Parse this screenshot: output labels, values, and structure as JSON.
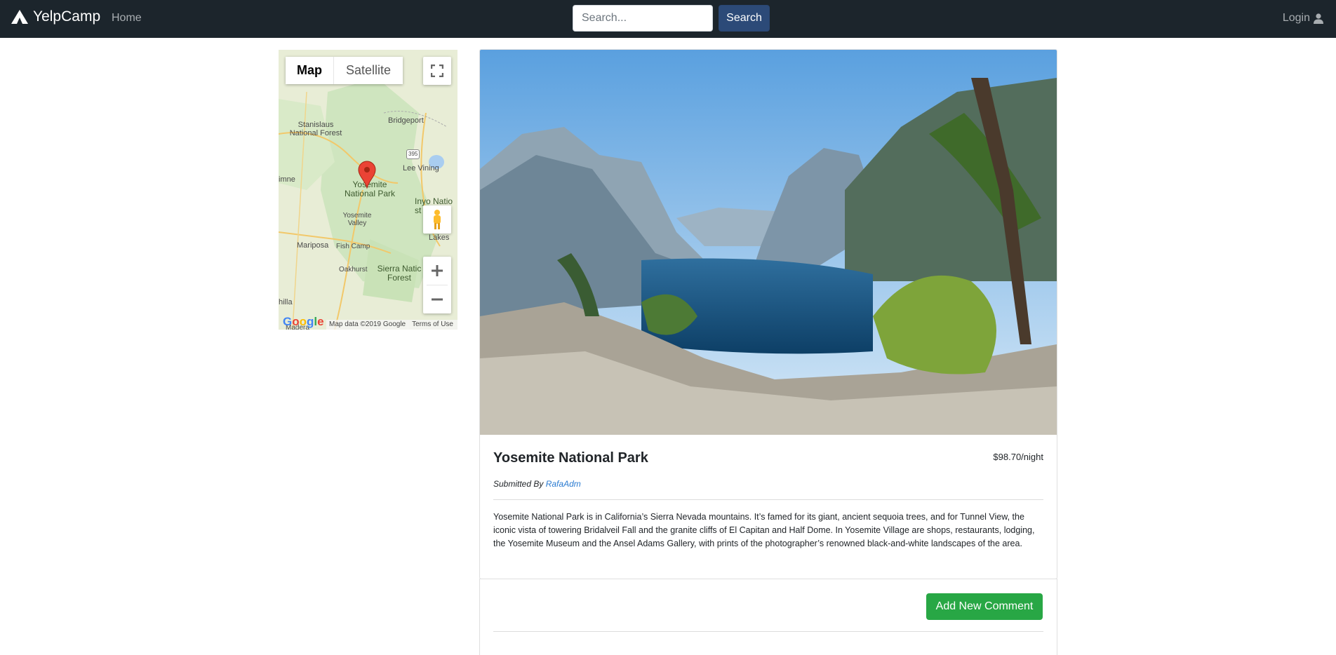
{
  "navbar": {
    "brand": "YelpCamp",
    "home_label": "Home",
    "search_placeholder": "Search...",
    "search_button": "Search",
    "login_label": "Login"
  },
  "map": {
    "tab_map": "Map",
    "tab_satellite": "Satellite",
    "labels": {
      "stanislaus": "Stanislaus National Forest",
      "bridgeport": "Bridgeport",
      "hwy": "395",
      "lee_vining": "Lee Vining",
      "yosemite_np": "Yosemite National Park",
      "inyo": "Inyo Natio st",
      "yosemite_valley": "Yosemite Valley",
      "lakes": "Lakes",
      "mariposa": "Mariposa",
      "fish_camp": "Fish Camp",
      "oakhurst": "Oakhurst",
      "sierra_forest": "Sierra Natic Forest",
      "imne": "imne",
      "hilla": "hilla",
      "madera": "Madera"
    },
    "google": "Google",
    "attribution": "Map data ©2019 Google",
    "terms": "Terms of Use"
  },
  "campground": {
    "name": "Yosemite National Park",
    "price": "$98.70/night",
    "submitted_prefix": "Submitted By",
    "author": "RafaAdm",
    "description": "Yosemite National Park is in California’s Sierra Nevada mountains. It’s famed for its giant, ancient sequoia trees, and for Tunnel View, the iconic vista of towering Bridalveil Fall and the granite cliffs of El Capitan and Half Dome. In Yosemite Village are shops, restaurants, lodging, the Yosemite Museum and the Ansel Adams Gallery, with prints of the photographer’s renowned black-and-white landscapes of the area."
  },
  "comments": {
    "add_button": "Add New Comment"
  },
  "colors": {
    "navbar": "#1c252c",
    "search_button": "#2c4a78",
    "add_comment": "#28a745",
    "link": "#2a7bd1"
  }
}
